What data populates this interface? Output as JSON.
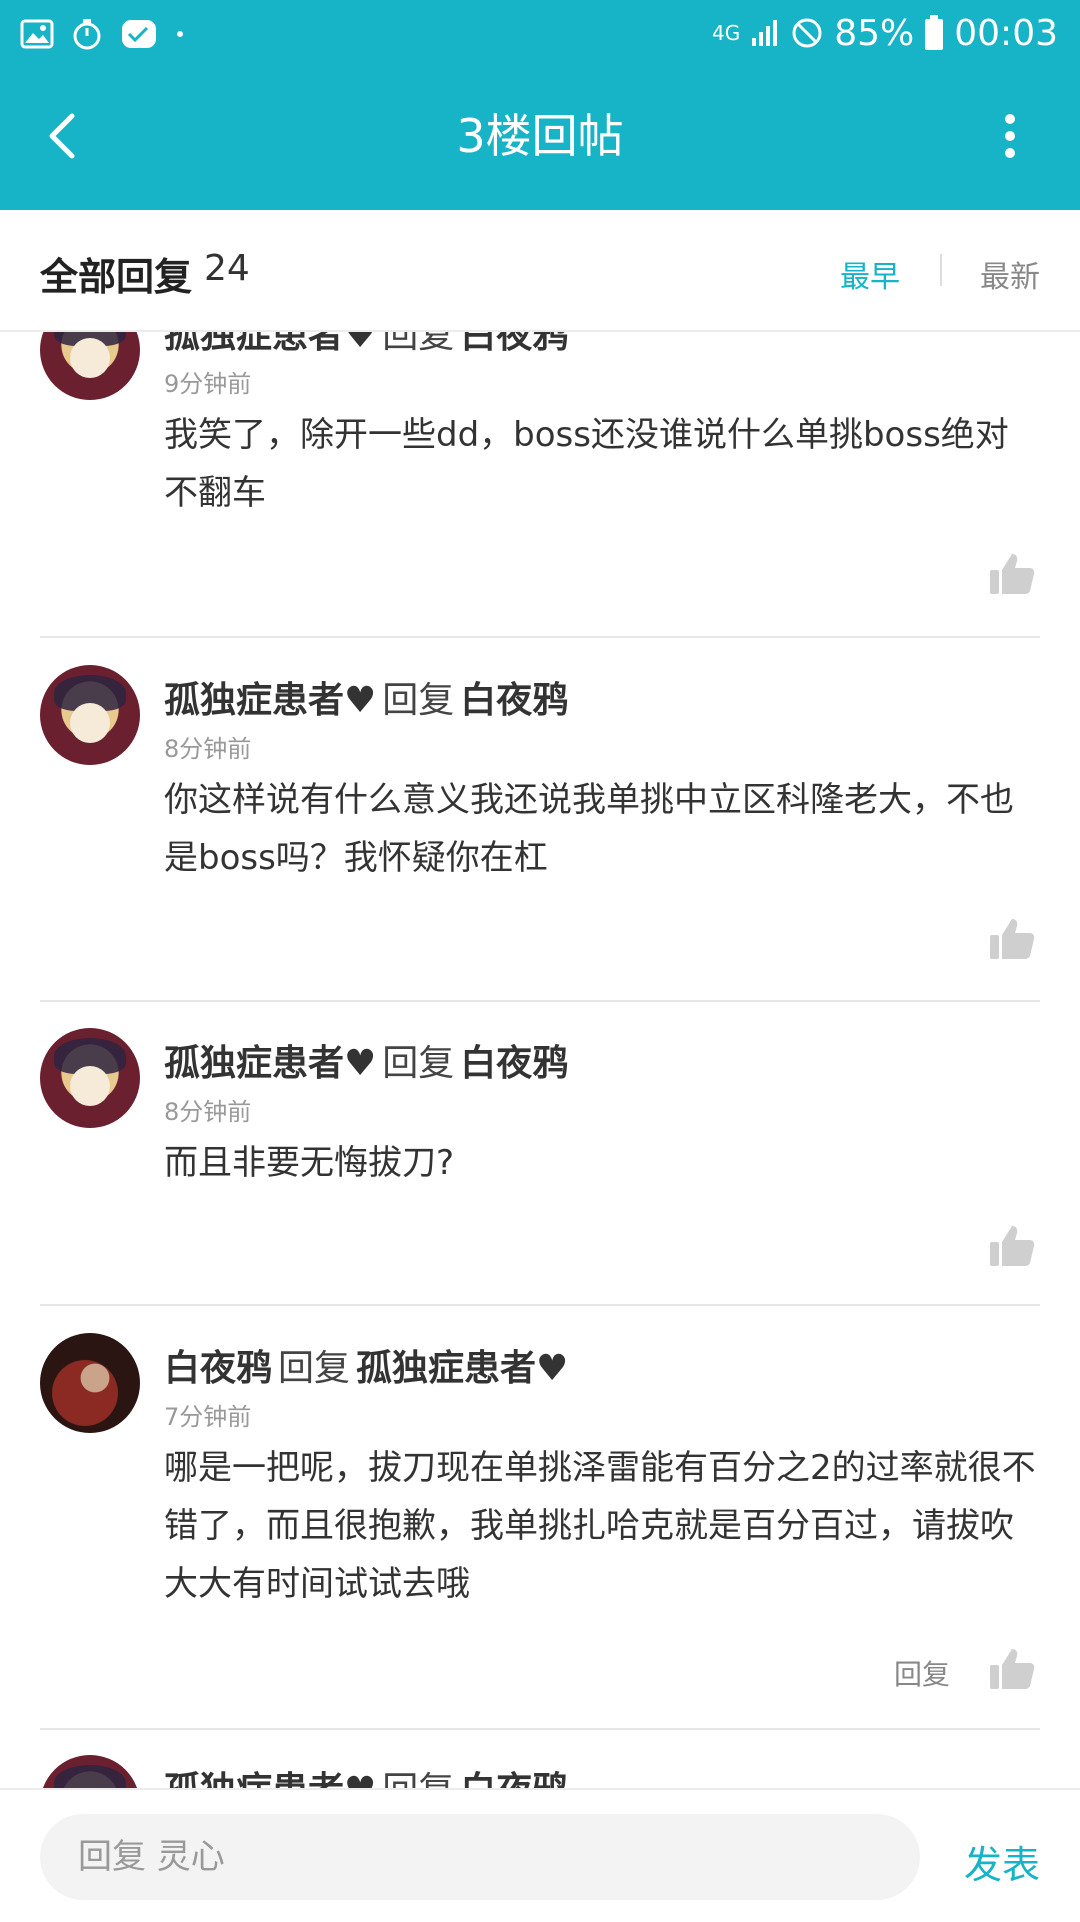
{
  "status_bar": {
    "network": "4G",
    "battery": "85%",
    "time": "00:03"
  },
  "toolbar": {
    "title": "3楼回帖"
  },
  "filter": {
    "label": "全部回复",
    "count": "24",
    "sort_earliest": "最早",
    "sort_latest": "最新"
  },
  "reply_word": "回复",
  "comments": [
    {
      "author": "孤独症患者♥",
      "reply_to": "白夜鸦",
      "time": "9分钟前",
      "text": "我笑了，除开一些dd，boss还没谁说什么单挑boss绝对不翻车"
    },
    {
      "author": "孤独症患者♥",
      "reply_to": "白夜鸦",
      "time": "8分钟前",
      "text": "你这样说有什么意义我还说我单挑中立区科隆老大，不也是boss吗？我怀疑你在杠"
    },
    {
      "author": "孤独症患者♥",
      "reply_to": "白夜鸦",
      "time": "8分钟前",
      "text": "而且非要无悔拔刀?"
    },
    {
      "author": "白夜鸦",
      "reply_to": "孤独症患者♥",
      "time": "7分钟前",
      "text": "哪是一把呢，拔刀现在单挑泽雷能有百分之2的过率就很不错了，而且很抱歉，我单挑扎哈克就是百分百过，请拔吹大大有时间试试去哦",
      "action": "回复"
    },
    {
      "author": "孤独症患者♥",
      "reply_to": "白夜鸦"
    }
  ],
  "composer": {
    "placeholder": "回复 灵心",
    "send": "发表"
  },
  "colors": {
    "accent": "#17b3c6"
  }
}
